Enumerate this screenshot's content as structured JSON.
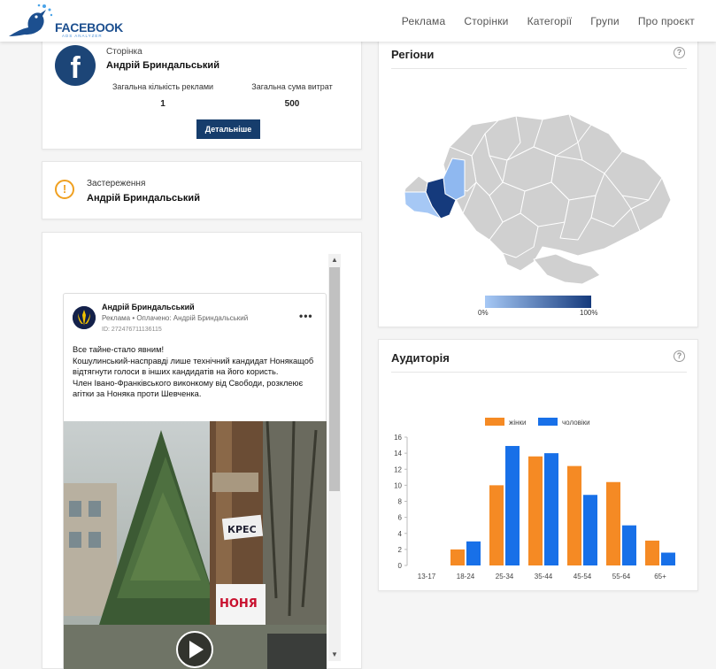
{
  "header": {
    "logo_text": "FACEBOOK",
    "logo_sub": "ADS ANALYZER",
    "nav": [
      "Реклама",
      "Сторінки",
      "Категорії",
      "Групи",
      "Про проєкт"
    ]
  },
  "page_card": {
    "label": "Сторінка",
    "name": "Андрій Бриндальський",
    "ads_count_label": "Загальна кількість реклами",
    "ads_count": "1",
    "spend_label": "Загальна сума витрат",
    "spend": "500",
    "button": "Детальніше"
  },
  "warning_card": {
    "label": "Застереження",
    "name": "Андрій Бриндальський"
  },
  "ad_post": {
    "page_name": "Андрій Бриндальський",
    "meta": "Реклама • Оплачено: Андрій Бриндальський",
    "id": "ID: 272476711136115",
    "text_lines": [
      "Все тайне-стало явним!",
      "Кошулинський-насправді лише технічний кандидат Нонякащоб відтягнути голоси в інших кандидатів на його користь.",
      "Член Івано-Франківського виконкому від Свободи, розклеює агітки за Ноняка проти Шевченка."
    ],
    "poster_text": "КРЕС",
    "poster_text2": "НОНЯ"
  },
  "regions": {
    "title": "Регіони",
    "help": "?",
    "legend_min": "0%",
    "legend_max": "100%",
    "colors": {
      "base": "#d0d0d0",
      "high": "#153a7c",
      "mid": "#8fb8f0",
      "low": "#a6c8f5"
    }
  },
  "audience": {
    "title": "Аудиторія",
    "help": "?"
  },
  "chart_data": {
    "type": "bar",
    "categories": [
      "13-17",
      "18-24",
      "25-34",
      "35-44",
      "45-54",
      "55-64",
      "65+"
    ],
    "series": [
      {
        "name": "жінки",
        "color": "#f58a24",
        "values": [
          0,
          2,
          10,
          13.6,
          12.4,
          10.4,
          3.1
        ]
      },
      {
        "name": "чоловіки",
        "color": "#1870e8",
        "values": [
          0,
          3,
          14.9,
          14,
          8.8,
          5,
          1.6
        ]
      }
    ],
    "ylim": [
      0,
      16
    ],
    "yticks": [
      0,
      2,
      4,
      6,
      8,
      10,
      12,
      14,
      16
    ],
    "grid": false,
    "legend": "top-center"
  }
}
